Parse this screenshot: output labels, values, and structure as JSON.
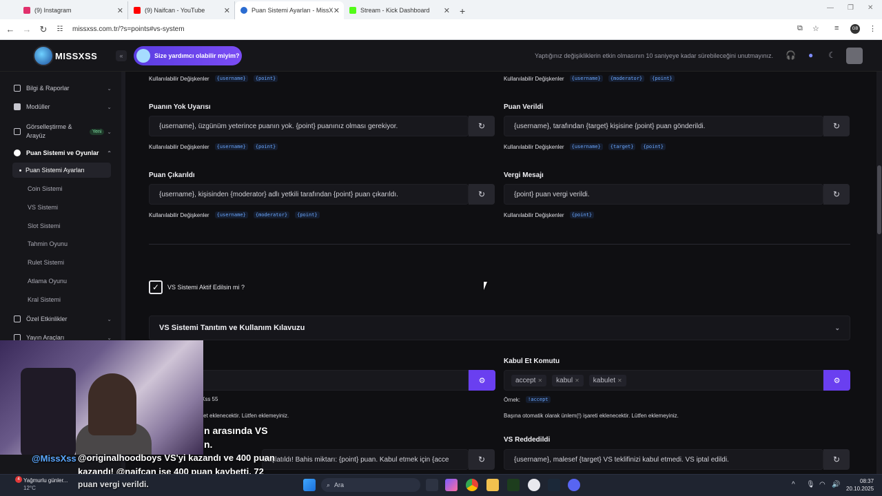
{
  "browser": {
    "tabs": [
      {
        "label": "(9) Instagram",
        "color": "#e1306c"
      },
      {
        "label": "(9) Naifcan - YouTube",
        "color": "#ff0000"
      },
      {
        "label": "Puan Sistemi Ayarları - MissXss",
        "color": "#2b6cd1"
      },
      {
        "label": "Stream - Kick Dashboard",
        "color": "#53fc18"
      }
    ],
    "url": "missxss.com.tr/?s=points#vs-system",
    "profile_initials": "GB"
  },
  "header": {
    "logo_text": "MISSXSS",
    "help_label": "Size yardımcı olabilir miyim?",
    "notice": "Yaptığınız değişikliklerin etkin olmasının 10 saniyeye kadar sürebileceğini unutmayınız."
  },
  "sidebar": {
    "items": [
      {
        "label": "Bilgi & Raporlar"
      },
      {
        "label": "Modüller"
      },
      {
        "label": "Görselleştirme &",
        "label2": "Arayüz",
        "badge": "Yeni"
      },
      {
        "label": "Puan Sistemi ve Oyunlar"
      },
      {
        "label": "Özel Etkinlikler"
      },
      {
        "label": "Yayın Araçları"
      }
    ],
    "subitems": [
      "Puan Sistemi Ayarları",
      "Coin Sistemi",
      "VS Sistemi",
      "Slot Sistemi",
      "Tahmin Oyunu",
      "Rulet Sistemi",
      "Atlama Oyunu",
      "Kral Sistemi"
    ]
  },
  "main": {
    "vars_label": "Kullanılabilir Değişkenler",
    "top_vars_left": [
      "{username}",
      "{point}"
    ],
    "top_vars_right": [
      "{username}",
      "{moderator}",
      "{point}"
    ],
    "fields": [
      {
        "label": "Puanın Yok Uyarısı",
        "value": "{username}, üzgünüm yeterince puanın yok. {point} puanınız olması gerekiyor.",
        "vars": [
          "{username}",
          "{point}"
        ]
      },
      {
        "label": "Puan Verildi",
        "value": "{username}, tarafından {target} kişisine {point} puan gönderildi.",
        "vars": [
          "{username}",
          "{target}",
          "{point}"
        ]
      },
      {
        "label": "Puan Çıkarıldı",
        "value": "{username}, kişisinden {moderator} adlı yetkili tarafından {point} puan çıkarıldı.",
        "vars": [
          "{username}",
          "{moderator}",
          "{point}"
        ]
      },
      {
        "label": "Vergi Mesajı",
        "value": "{point} puan vergi verildi.",
        "vars": [
          "{point}"
        ]
      }
    ],
    "vs_checkbox_label": "VS Sistemi Aktif Edilsin mi ?",
    "accordion_title": "VS Sistemi Tanıtım ve Kullanım Kılavuzu",
    "accept_label": "Kabul Et Komutu",
    "accept_tags": [
      "accept",
      "kabul",
      "kabulet"
    ],
    "example_label": "Örnek:",
    "example_value": "!accept",
    "prefix_note": "Başına otomatik olarak ünlem(!) işareti eklenecektir. Lütfen eklemeyiniz.",
    "left_partial_example": "sXss 55",
    "left_partial_note": "aret eklenecektir. Lütfen eklemeyiniz.",
    "reject_label": "VS Reddedildi",
    "reject_value": "{username}, malesef {target} VS teklifinizi kabul etmedi. VS iptal edildi.",
    "left_bottom_value": "başlatıldı! Bahis miktarı: {point} puan. Kabul etmek için {acce"
  },
  "stream_overlay": {
    "line1": "n arasında VS",
    "line2": "n.",
    "user": "@MissXss",
    "chat1": "@originalhoodboys VS'yi kazandı ve 400 puan",
    "chat2": "kazandı! @naifcan ise 400 puan kaybetti. 72",
    "chat3": "puan vergi verildi."
  },
  "taskbar": {
    "weather": "Yağmurlu günler...",
    "temp": "12°C",
    "badge": "4",
    "search": "Ara",
    "time": "08:37",
    "date": "20.10.2025"
  }
}
